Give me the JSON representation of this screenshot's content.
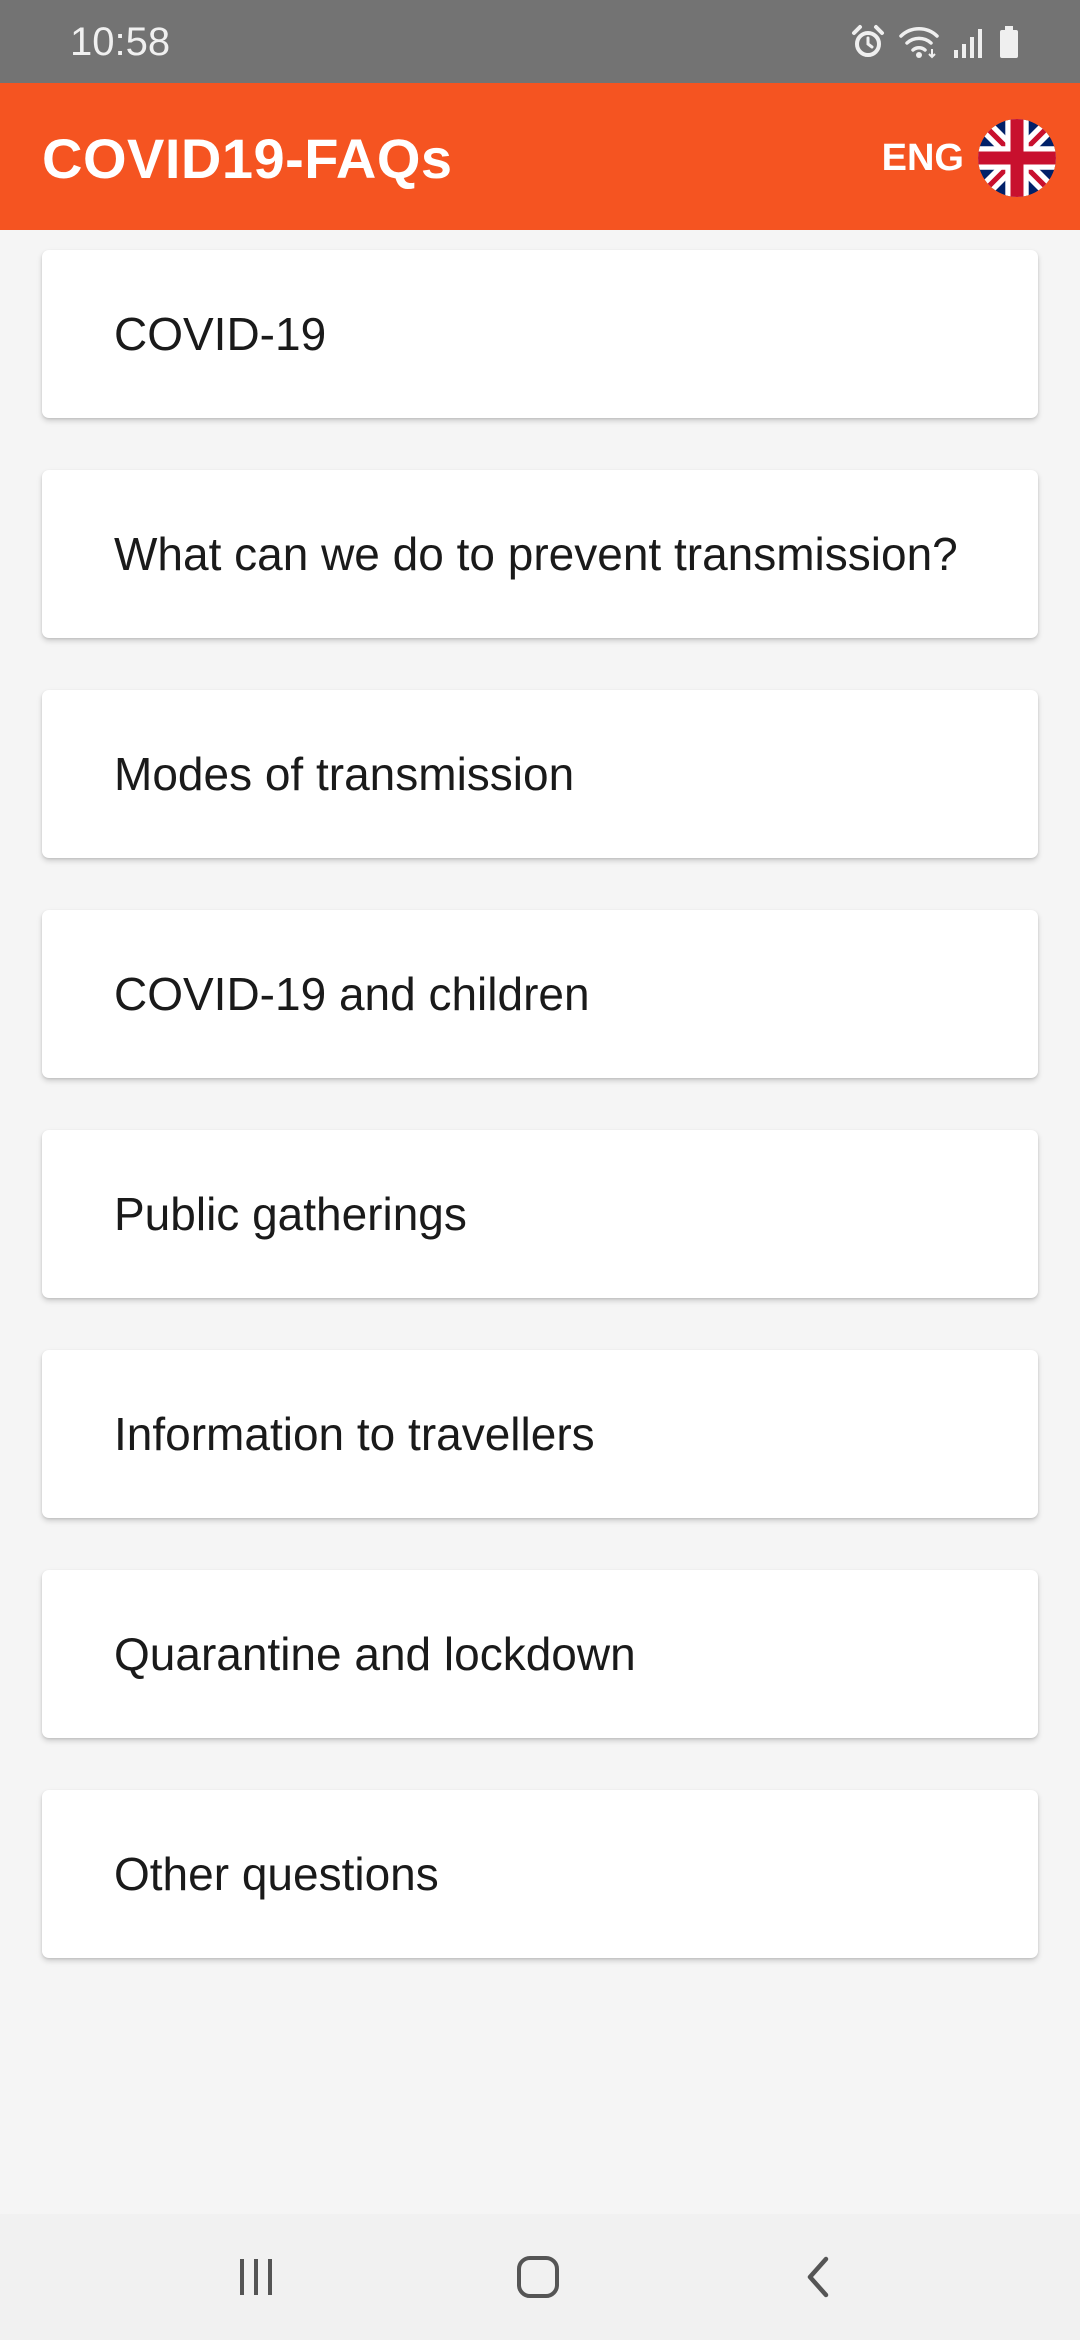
{
  "status_bar": {
    "time": "10:58",
    "icons": [
      "alarm-icon",
      "wifi-icon",
      "signal-icon",
      "battery-icon"
    ]
  },
  "app_bar": {
    "title": "COVID19-FAQs",
    "language_label": "ENG",
    "language_flag": "uk-flag-icon",
    "color": "#f55421"
  },
  "faq": {
    "items": [
      {
        "label": "COVID-19"
      },
      {
        "label": "What can we do to prevent transmission?"
      },
      {
        "label": "Modes of transmission"
      },
      {
        "label": "COVID-19 and children"
      },
      {
        "label": "Public gatherings"
      },
      {
        "label": "Information to travellers"
      },
      {
        "label": "Quarantine and lockdown"
      },
      {
        "label": "Other questions"
      }
    ]
  },
  "nav_bar": {
    "buttons": [
      "recent-apps-icon",
      "home-icon",
      "back-icon"
    ]
  }
}
